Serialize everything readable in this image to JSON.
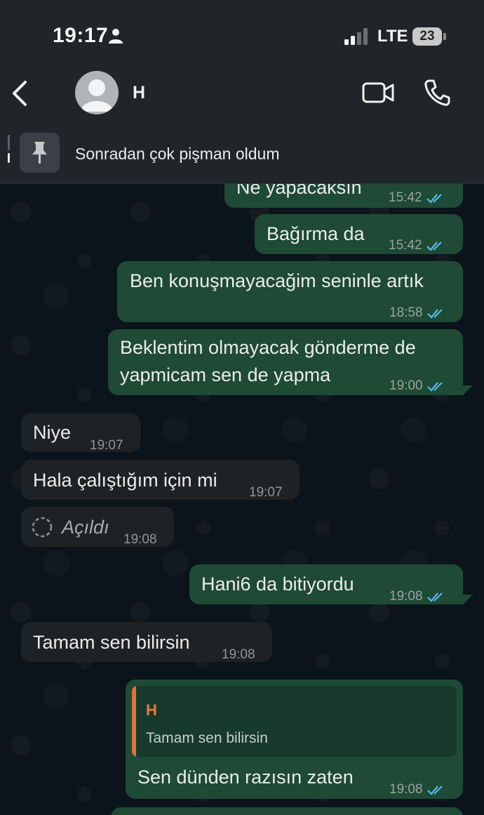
{
  "status_bar": {
    "time": "19:17",
    "network": "LTE",
    "battery": "23"
  },
  "header": {
    "contact_name": "H",
    "icons": [
      "back-icon",
      "avatar-icon",
      "video-call-icon",
      "phone-icon"
    ]
  },
  "pinned": {
    "icon": "pin-icon",
    "text": "Sonradan çok pişman oldum"
  },
  "messages": [
    {
      "direction": "out",
      "text": "Ne yapacaksın",
      "time": "15:42",
      "status": "read"
    },
    {
      "direction": "out",
      "text": "Bağırma da",
      "time": "15:42",
      "status": "read"
    },
    {
      "direction": "out",
      "text": "Ben konuşmayacağim seninle artık",
      "time": "18:58",
      "status": "read"
    },
    {
      "direction": "out",
      "text_line1": "Beklentim olmayacak gönderme de",
      "text_line2": "yapmicam sen de yapma",
      "time": "19:00",
      "status": "read"
    },
    {
      "direction": "in",
      "text": "Niye",
      "time": "19:07"
    },
    {
      "direction": "in",
      "text": "Hala çalıştığım için mi",
      "time": "19:07"
    },
    {
      "direction": "in",
      "text": "Açıldı",
      "time": "19:08",
      "icon": "view-once-opened-icon"
    },
    {
      "direction": "out",
      "text": "Hani6 da bitiyordu",
      "time": "19:08",
      "status": "read"
    },
    {
      "direction": "in",
      "text": "Tamam sen bilirsin",
      "time": "19:08"
    },
    {
      "direction": "out",
      "reply_author": "H",
      "reply_text": "Tamam sen bilirsin",
      "text": "Sen dünden razısın zaten",
      "time": "19:08",
      "status": "read"
    }
  ],
  "colors": {
    "outgoing_bubble": "#1e4a36",
    "incoming_bubble": "#1f2225",
    "read_ticks": "#53bdeb",
    "reply_accent": "#f07a3e"
  }
}
